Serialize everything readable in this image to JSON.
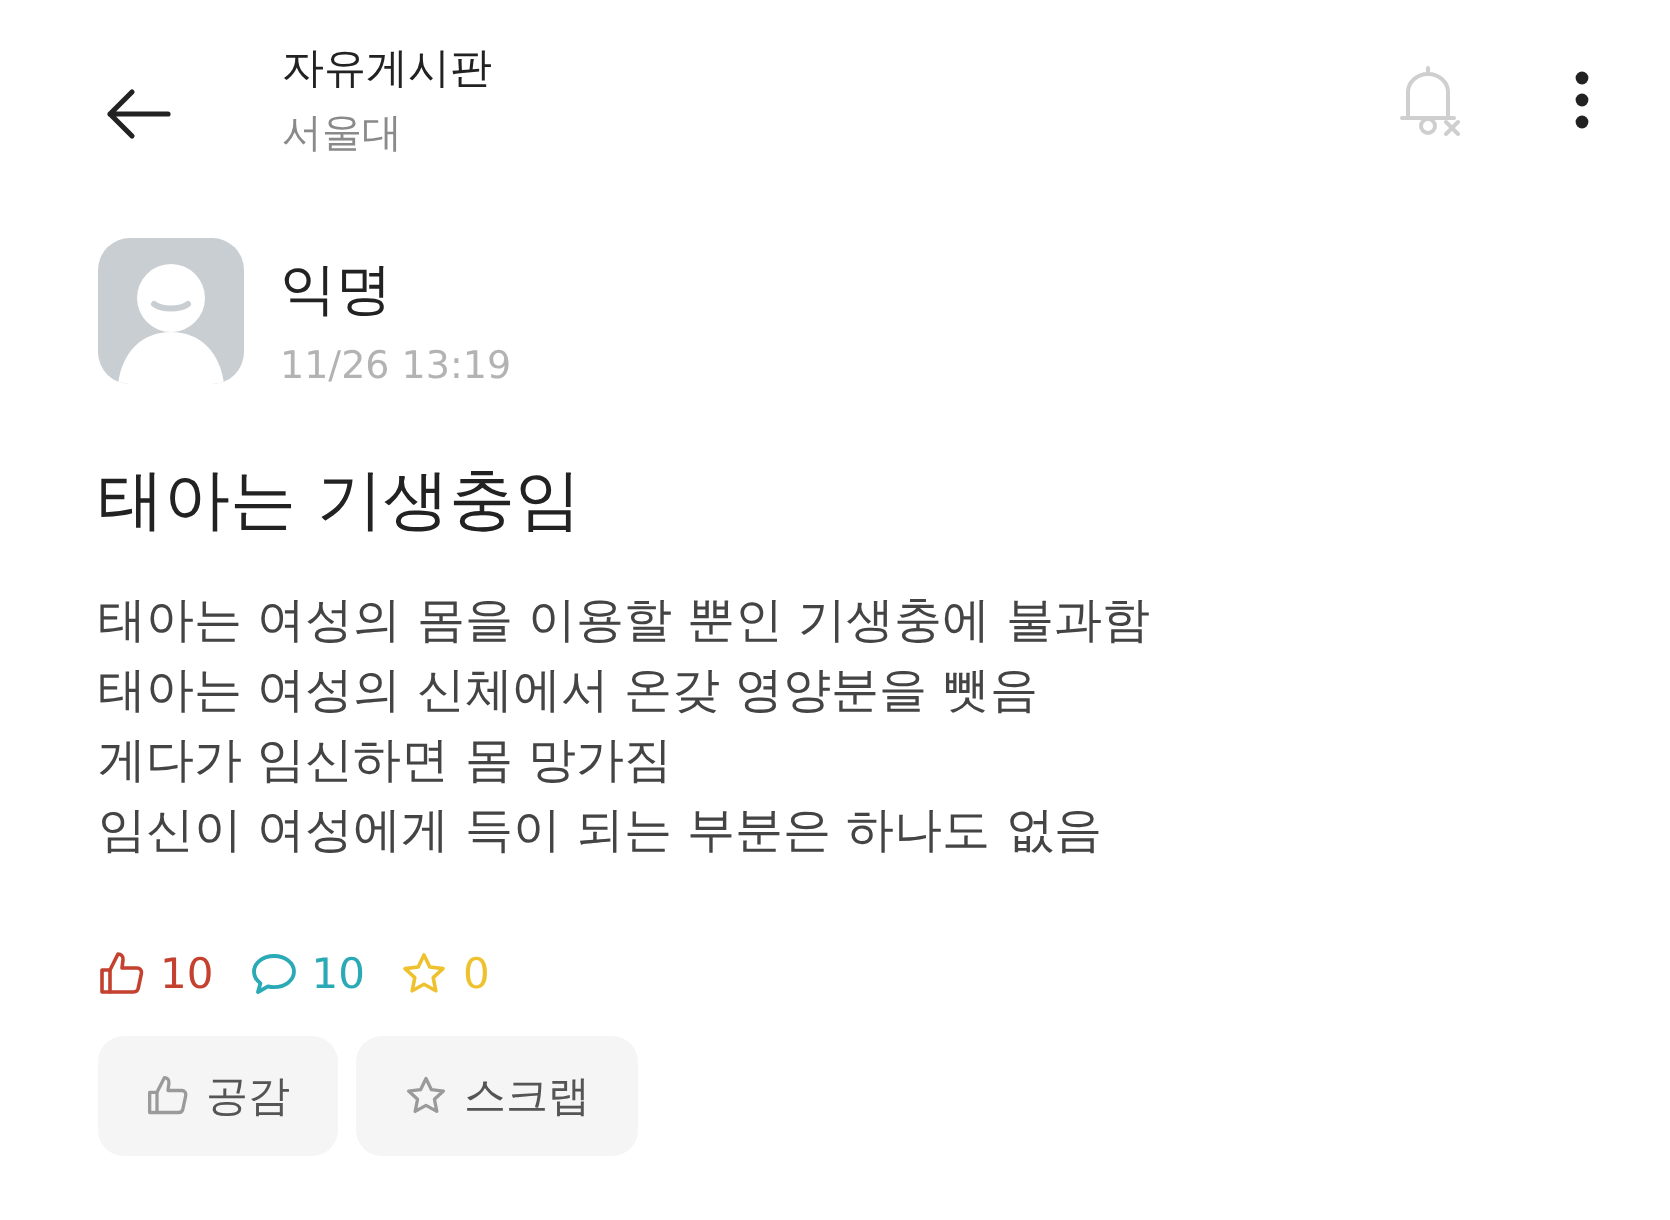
{
  "header": {
    "board_title": "자유게시판",
    "school": "서울대"
  },
  "post": {
    "author": "익명",
    "time": "11/26 13:19",
    "title": "태아는 기생충임",
    "body_lines": [
      "태아는 여성의 몸을 이용할 뿐인 기생충에 불과함",
      "태아는 여성의 신체에서 온갖 영양분을 뺏음",
      "게다가 임신하면 몸 망가짐",
      "임신이 여성에게 득이 되는 부분은 하나도 없음"
    ]
  },
  "stats": [
    {
      "kind": "like",
      "count": "10",
      "color": "#c4402f"
    },
    {
      "kind": "comment",
      "count": "10",
      "color": "#2aa9b7"
    },
    {
      "kind": "scrap",
      "count": "0",
      "color": "#eec22e"
    }
  ],
  "actions": [
    {
      "kind": "like",
      "label": "공감"
    },
    {
      "kind": "scrap",
      "label": "스크랩"
    }
  ]
}
